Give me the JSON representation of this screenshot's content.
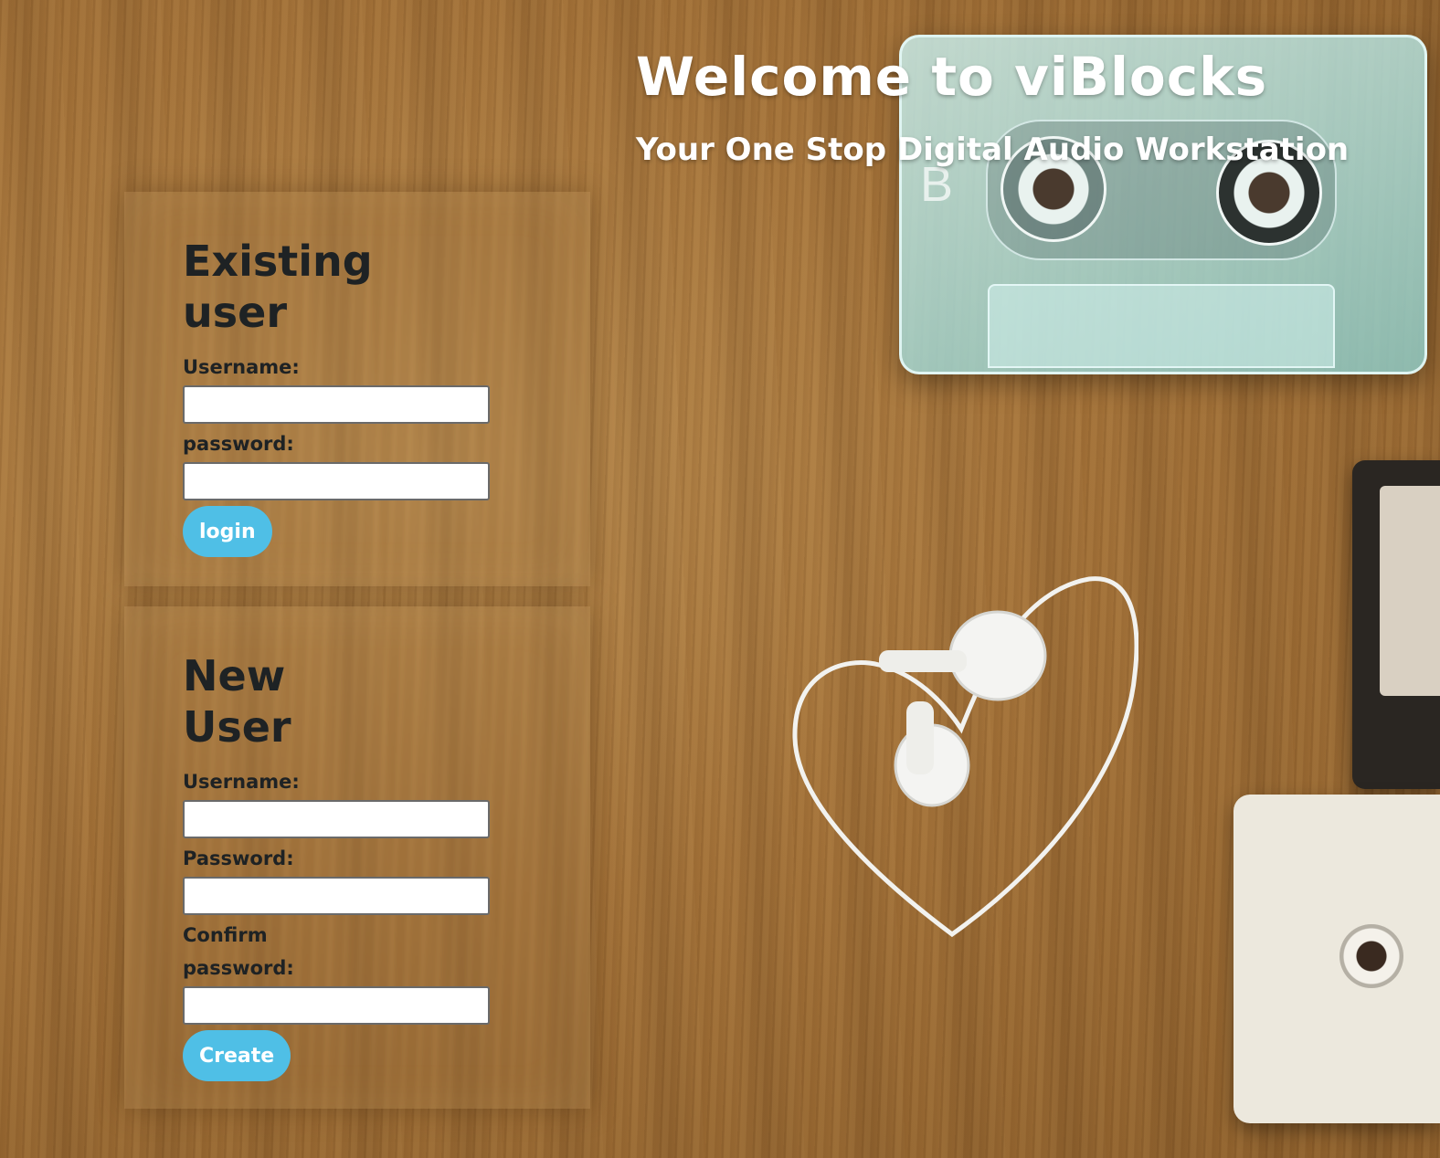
{
  "header": {
    "title": "Welcome to viBlocks",
    "subtitle": "Your One Stop Digital Audio Workstation"
  },
  "existing_user": {
    "heading": "Existing user",
    "username_label": "Username:",
    "password_label": "password:",
    "username_value": "",
    "password_value": "",
    "login_button": "login"
  },
  "new_user": {
    "heading": "New User",
    "username_label": "Username:",
    "password_label": "Password:",
    "confirm_label": "Confirm password:",
    "username_value": "",
    "password_value": "",
    "confirm_value": "",
    "create_button": "Create"
  },
  "colors": {
    "button": "#4fbfe6",
    "heading_text": "#1e2224",
    "title_text": "#ffffff"
  },
  "background": {
    "cassette_label": "B",
    "icons": [
      "cassette-tape-image",
      "heart-earphones-image"
    ]
  }
}
